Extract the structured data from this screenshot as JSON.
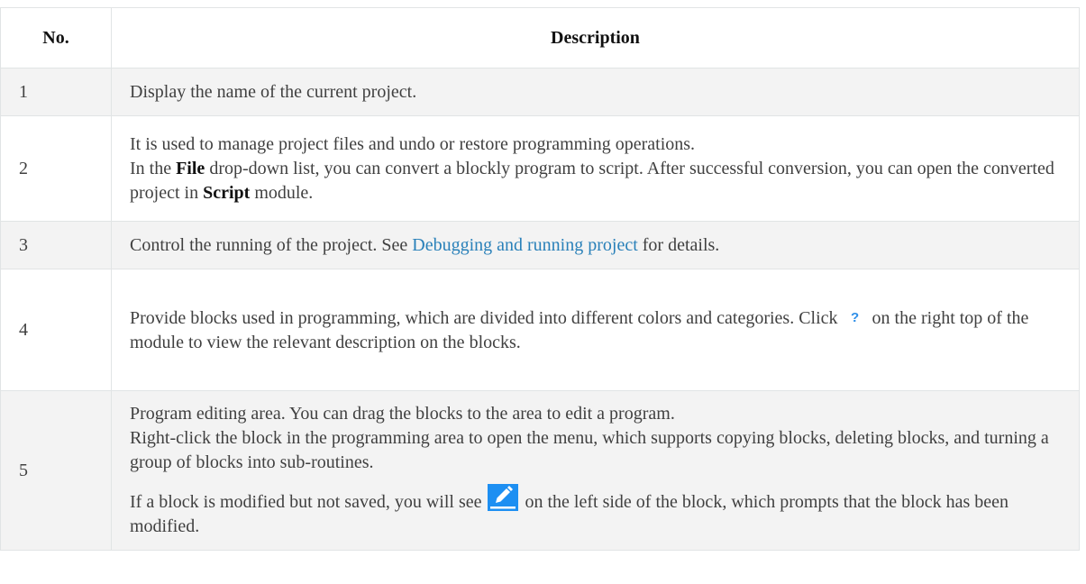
{
  "table": {
    "headers": {
      "no": "No.",
      "description": "Description"
    },
    "rows": [
      {
        "no": "1",
        "text": "Display the name of the current project."
      },
      {
        "no": "2",
        "line1": "It is used to manage project files and undo or restore programming operations.",
        "line2_pre": "In the ",
        "line2_bold": "File",
        "line2_mid": " drop-down list, you can convert a blockly program to script. After successful conversion, you can open the converted project in ",
        "line2_bold2": "Script",
        "line2_post": " module."
      },
      {
        "no": "3",
        "pre": "Control the running of the project. See ",
        "link": "Debugging and running project",
        "post": " for details."
      },
      {
        "no": "4",
        "pre": "Provide blocks used in programming, which are divided into different colors and categories. Click",
        "icon": "help-icon",
        "post": "on the right top of the module to view the relevant description on the blocks."
      },
      {
        "no": "5",
        "para1": "Program editing area. You can drag the blocks to the area to edit a program.",
        "para2": "Right-click the block in the programming area to open the menu, which supports copying blocks, deleting blocks, and turning a group of blocks into sub-routines.",
        "para3_pre": "If a block is modified but not saved, you will see",
        "icon": "edit-icon",
        "para3_post": "on the left side of the block, which prompts that the block has been modified."
      }
    ]
  },
  "colors": {
    "link": "#2980b9",
    "stripe": "#f3f3f3",
    "border": "#e1e4e5",
    "edit_icon_bg": "#1d8ff2"
  }
}
